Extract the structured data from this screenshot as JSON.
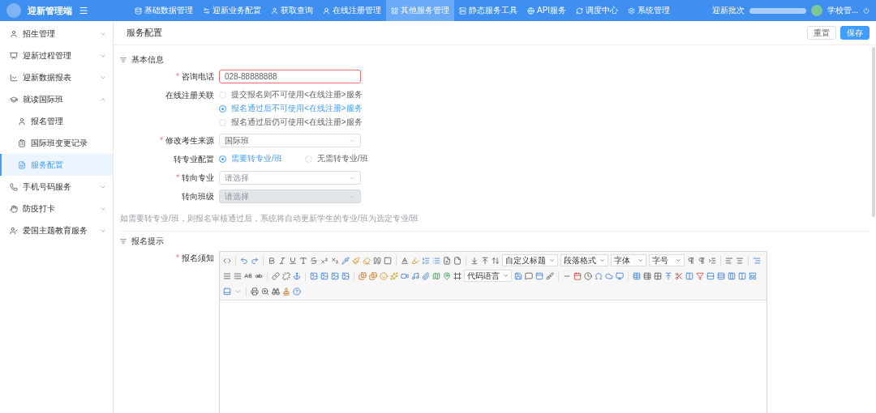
{
  "app": {
    "title": "迎新管理端"
  },
  "top_nav": [
    {
      "label": "基础数据管理",
      "selected": false
    },
    {
      "label": "迎新业务配置",
      "selected": false
    },
    {
      "label": "获取查询",
      "selected": false
    },
    {
      "label": "在线注册管理",
      "selected": false
    },
    {
      "label": "其他服务管理",
      "selected": true
    },
    {
      "label": "静态服务工具",
      "selected": false
    },
    {
      "label": "API服务",
      "selected": false
    },
    {
      "label": "调度中心",
      "selected": false
    },
    {
      "label": "系统管理",
      "selected": false
    }
  ],
  "header_right": {
    "batch_label": "迎新批次",
    "user": "学校管..."
  },
  "sidebar": {
    "items": [
      {
        "label": "招生管理",
        "expanded": false,
        "selected": false
      },
      {
        "label": "迎新过程管理",
        "expanded": false,
        "selected": false
      },
      {
        "label": "迎新数据报表",
        "expanded": false,
        "selected": false
      },
      {
        "label": "就读国际班",
        "expanded": true,
        "selected": false,
        "children": [
          {
            "label": "报名管理",
            "selected": false
          },
          {
            "label": "国际班变更记录",
            "selected": false
          },
          {
            "label": "服务配置",
            "selected": true
          }
        ]
      },
      {
        "label": "手机号码服务",
        "expanded": false,
        "selected": false
      },
      {
        "label": "防疫打卡",
        "expanded": false,
        "selected": false
      },
      {
        "label": "爱国主题教育服务",
        "expanded": false,
        "selected": false
      }
    ]
  },
  "page": {
    "title": "服务配置",
    "buttons": [
      {
        "label": "重置",
        "kind": "default"
      },
      {
        "label": "保存",
        "kind": "primary"
      }
    ]
  },
  "sections": [
    {
      "title": "基本信息",
      "fields": [
        {
          "kind": "text",
          "required_mark": "*",
          "label": "咨询电话",
          "value": "028-88888888",
          "error": true
        },
        {
          "kind": "radio",
          "label": "在线注册关联",
          "options": [
            {
              "label": "提交报名则不可使用<在线注册>服务",
              "selected": false
            },
            {
              "label": "报名通过后不可使用<在线注册>服务",
              "selected": true
            },
            {
              "label": "报名通过后仍可使用<在线注册>服务",
              "selected": false
            }
          ]
        },
        {
          "kind": "select",
          "required_mark": "*",
          "label": "修改考生来源",
          "value": "国际班",
          "disabled": false
        },
        {
          "kind": "radio",
          "label": "转专业配置",
          "options": [
            {
              "label": "需要转专业/班",
              "selected": true
            },
            {
              "label": "无需转专业/班",
              "selected": false
            }
          ]
        },
        {
          "kind": "select",
          "required_mark": "*",
          "label": "转向专业",
          "placeholder": "请选择",
          "disabled": false
        },
        {
          "kind": "select",
          "label": "转向班级",
          "placeholder": "请选择",
          "disabled": true
        }
      ],
      "hint": "如需要转专业/班，则报名审核通过后，系统将自动更新学生的专业/班为选定专业/班"
    },
    {
      "title": "报名提示",
      "fields": [
        {
          "kind": "editor",
          "required_mark": "*",
          "label": "报名须知",
          "dropdowns": [
            "自定义标题",
            "段落格式",
            "字体",
            "字号",
            "代码语言"
          ]
        }
      ]
    }
  ]
}
